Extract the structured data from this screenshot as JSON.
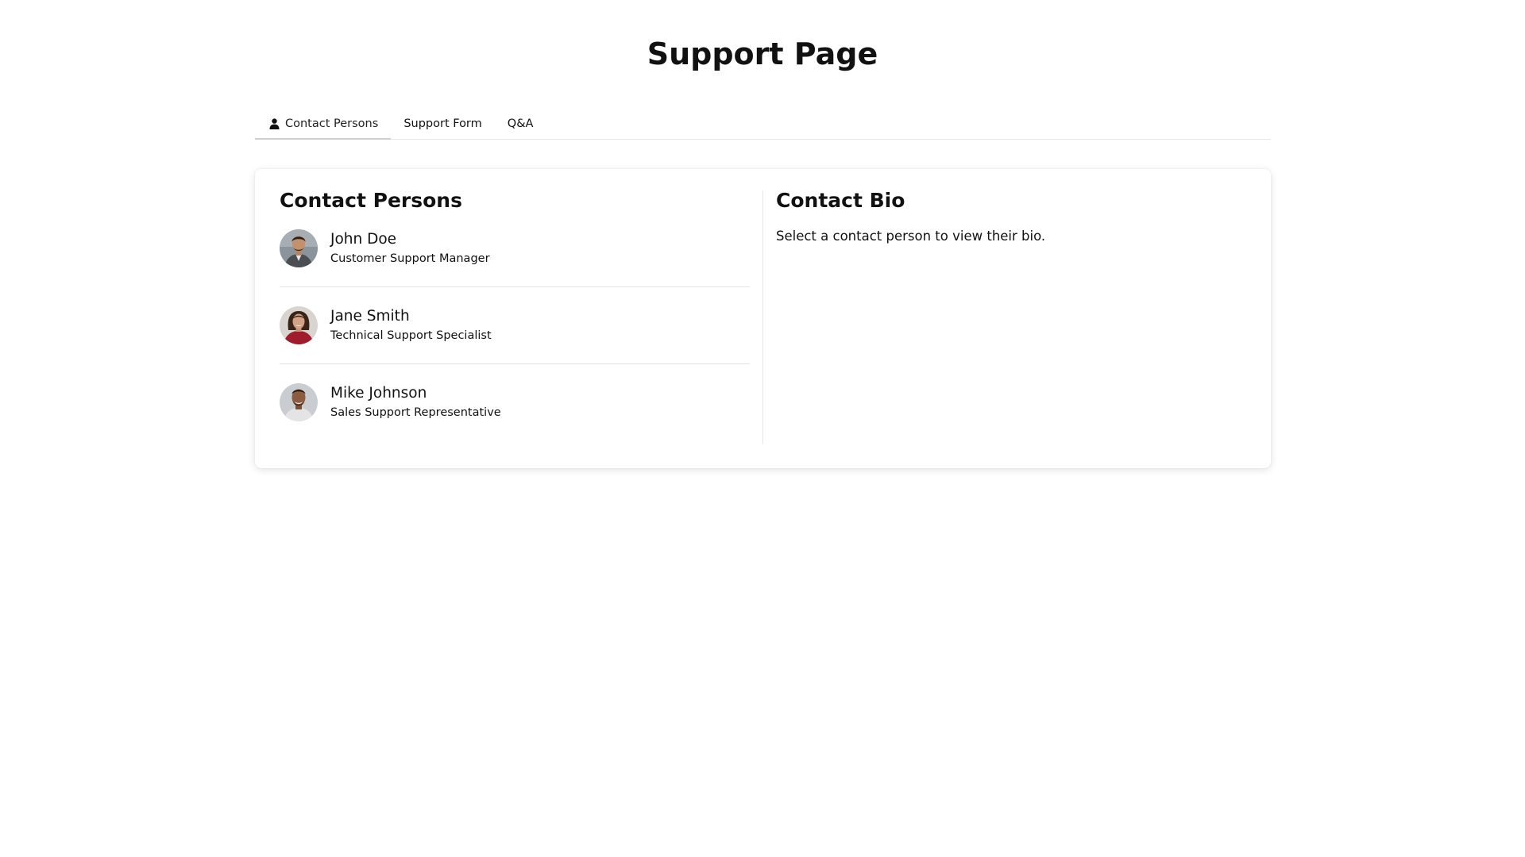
{
  "page": {
    "title": "Support Page"
  },
  "tabs": [
    {
      "label": "Contact Persons",
      "icon": "person-icon",
      "active": true
    },
    {
      "label": "Support Form",
      "active": false
    },
    {
      "label": "Q&A",
      "active": false
    }
  ],
  "contacts": {
    "title": "Contact Persons",
    "items": [
      {
        "name": "John Doe",
        "role": "Customer Support Manager",
        "avatar": "avatar-john-doe"
      },
      {
        "name": "Jane Smith",
        "role": "Technical Support Specialist",
        "avatar": "avatar-jane-smith"
      },
      {
        "name": "Mike Johnson",
        "role": "Sales Support Representative",
        "avatar": "avatar-mike-johnson"
      }
    ]
  },
  "bio": {
    "title": "Contact Bio",
    "placeholder": "Select a contact person to view their bio."
  },
  "colors": {
    "background": "#ffffff",
    "text": "#111111",
    "divider": "#e6e6e6",
    "active_tab_underline": "#cfcfcf"
  }
}
